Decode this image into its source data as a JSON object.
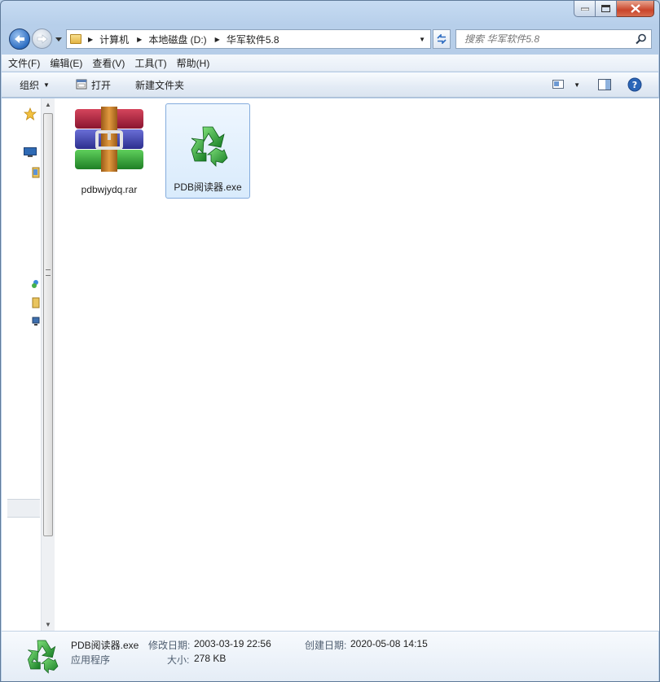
{
  "window": {
    "controls": {
      "minimize": "minimize",
      "maximize": "maximize",
      "close": "close"
    }
  },
  "address": {
    "crumbs": [
      "计算机",
      "本地磁盘 (D:)",
      "华军软件5.8"
    ]
  },
  "search": {
    "placeholder": "搜索 华军软件5.8"
  },
  "menu": {
    "items": [
      "文件(F)",
      "编辑(E)",
      "查看(V)",
      "工具(T)",
      "帮助(H)"
    ]
  },
  "toolbar": {
    "organize": "组织",
    "open": "打开",
    "new_folder": "新建文件夹"
  },
  "files": [
    {
      "name": "pdbwjydq.rar",
      "icon": "winrar-archive-icon",
      "selected": false
    },
    {
      "name": "PDB阅读器.exe",
      "icon": "green-recycle-app-icon",
      "selected": true
    }
  ],
  "details": {
    "name": "PDB阅读器.exe",
    "type": "应用程序",
    "modified_label": "修改日期:",
    "modified_value": "2003-03-19 22:56",
    "created_label": "创建日期:",
    "created_value": "2020-05-08 14:15",
    "size_label": "大小:",
    "size_value": "278 KB"
  },
  "colors": {
    "selection_border": "#84acdd",
    "window_frame": "#b9d1ea",
    "close_button": "#c9452b"
  }
}
